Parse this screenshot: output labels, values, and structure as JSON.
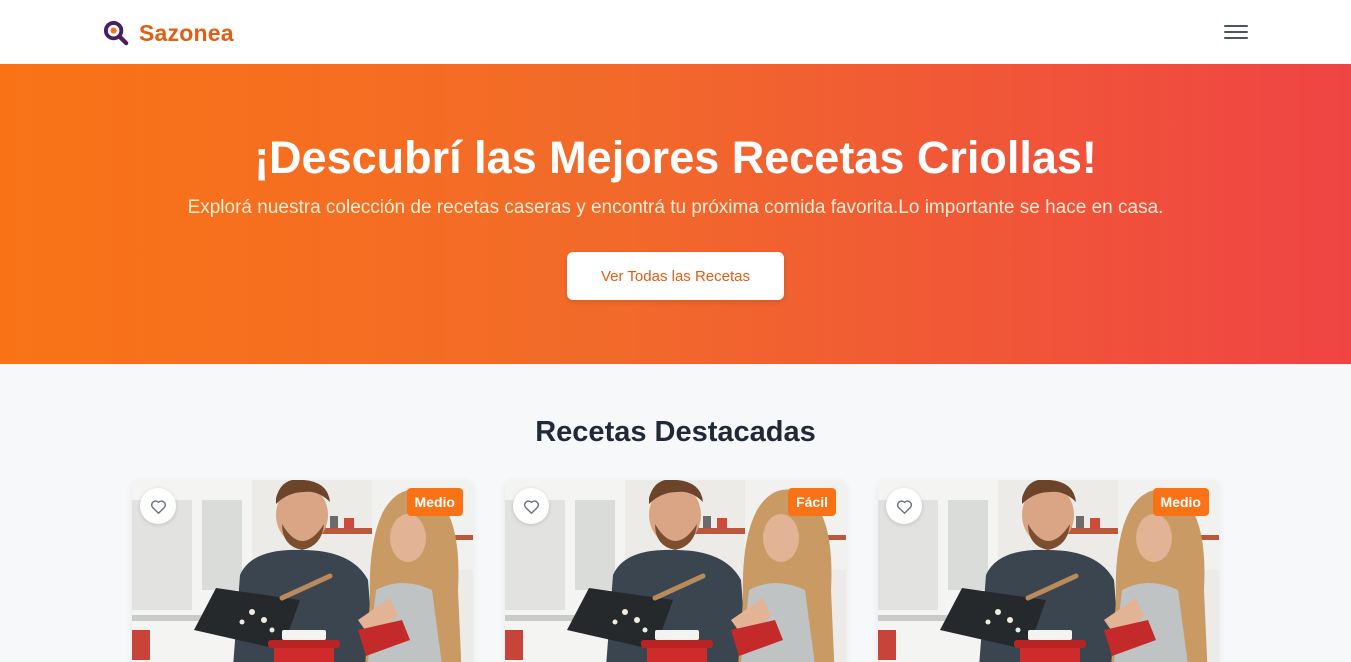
{
  "header": {
    "brand_name": "Sazonea",
    "logo_icon": "magnifier-logo-icon",
    "menu_icon": "hamburger-menu-icon"
  },
  "hero": {
    "title": "¡Descubrí las Mejores Recetas Criollas!",
    "subtitle": "Explorá nuestra colección de recetas caseras y encontrá tu próxima comida favorita.Lo importante se hace en casa.",
    "cta_label": "Ver Todas las Recetas"
  },
  "featured": {
    "title": "Recetas Destacadas",
    "cards": [
      {
        "difficulty": "Medio",
        "favorite_icon": "heart-outline-icon",
        "image": "couple-cooking-photo"
      },
      {
        "difficulty": "Fácil",
        "favorite_icon": "heart-outline-icon",
        "image": "couple-cooking-photo"
      },
      {
        "difficulty": "Medio",
        "favorite_icon": "heart-outline-icon",
        "image": "couple-cooking-photo"
      }
    ]
  },
  "colors": {
    "brand": "#e35d12",
    "hero_gradient_start": "#f97316",
    "hero_gradient_end": "#ef4444",
    "badge": "#f97316",
    "page_background": "#f7f8fa"
  }
}
